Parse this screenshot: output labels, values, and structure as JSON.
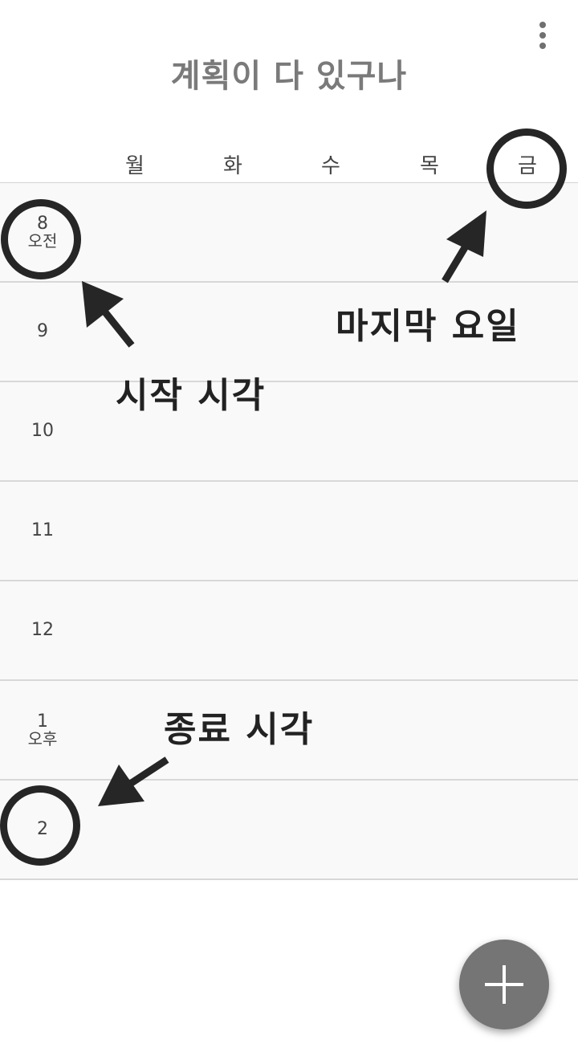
{
  "app": {
    "title": "계획이 다 있구나"
  },
  "header": {
    "menu_icon": "more-vert-icon",
    "days": [
      "월",
      "화",
      "수",
      "목",
      "금"
    ]
  },
  "timetable": {
    "hours": [
      {
        "num": "8",
        "ampm": "오전"
      },
      {
        "num": "9",
        "ampm": ""
      },
      {
        "num": "10",
        "ampm": ""
      },
      {
        "num": "11",
        "ampm": ""
      },
      {
        "num": "12",
        "ampm": ""
      },
      {
        "num": "1",
        "ampm": "오후"
      },
      {
        "num": "2",
        "ampm": ""
      }
    ]
  },
  "annotations": {
    "last_day": "마지막 요일",
    "start_time": "시작 시각",
    "end_time": "종료 시각",
    "color": "#262626"
  },
  "fab": {
    "icon": "plus-icon",
    "color": "#757575"
  }
}
